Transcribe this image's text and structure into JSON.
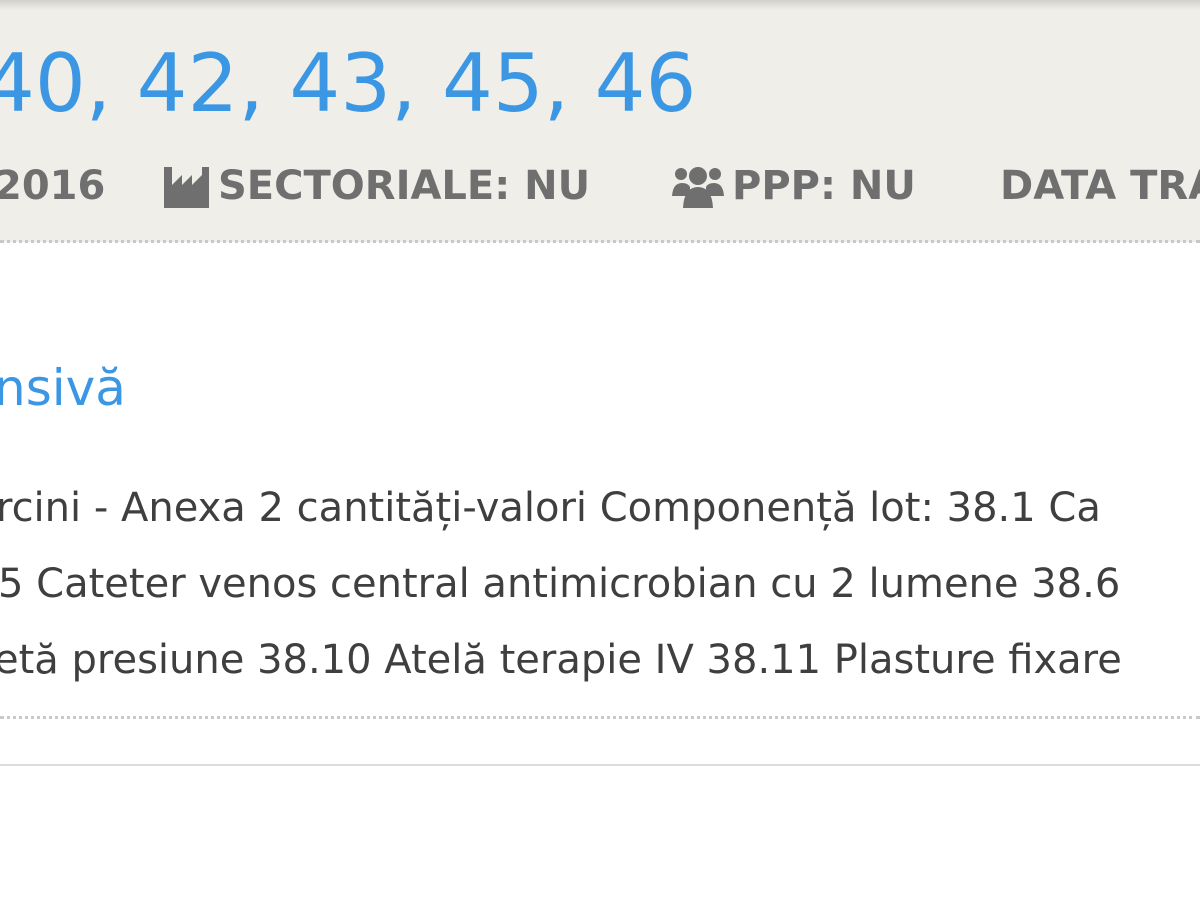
{
  "header": {
    "lots_title": "40, 42, 43, 45, 46",
    "meta": {
      "date_fragment": "2016",
      "sectoriale": "SECTORIALE: NU",
      "ppp": "PPP: NU",
      "data_fragment": "DATA TRA"
    },
    "icons": {
      "sectoriale": "factory-icon",
      "ppp": "group-icon"
    }
  },
  "section": {
    "title_fragment": "nsivă",
    "description_lines": [
      "rcini - Anexa 2 cantități-valori Componență lot: 38.1 Ca",
      "5 Cateter venos central antimicrobian cu 2 lumene 38.6",
      "etă presiune 38.10 Atelă terapie IV 38.11 Plasture fixare"
    ]
  },
  "colors": {
    "accent": "#3b97e3",
    "header_background": "#efeee8",
    "meta_text": "#6f6f6f",
    "body_text": "#3f3f3f"
  }
}
